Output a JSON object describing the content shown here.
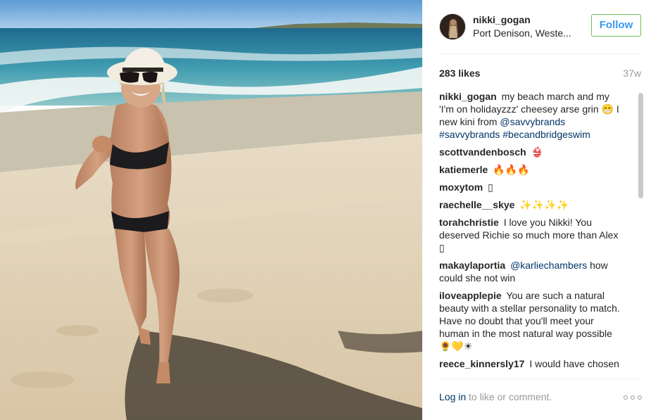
{
  "post": {
    "username": "nikki_gogan",
    "location": "Port Denison, Weste...",
    "follow_label": "Follow",
    "likes": "283 likes",
    "age": "37w"
  },
  "caption": {
    "author": "nikki_gogan",
    "text_1": "my beach march and my 'I'm on holidayzzz' cheesey arse grin 😁 I new kini from",
    "mention": "@savvybrands",
    "hashtags": "#savvybrands #becandbridgeswim"
  },
  "comments": [
    {
      "author": "scottvandenbosch",
      "text": "👙"
    },
    {
      "author": "katiemerle",
      "text": "🔥🔥🔥"
    },
    {
      "author": "moxytom",
      "text": "▯"
    },
    {
      "author": "raechelle__skye",
      "text": "✨✨✨✨"
    },
    {
      "author": "torahchristie",
      "text": "I love you Nikki! You deserved Richie so much more than Alex ▯"
    },
    {
      "author": "makaylaportia",
      "mention": "@karliechambers",
      "text": "how could she not win"
    },
    {
      "author": "iloveapplepie",
      "text": "You are such a natural beauty with a stellar personality to match. Have no doubt that you'll meet your human in the most natural way possible 🌻💛☀"
    },
    {
      "author": "reece_kinnersly17",
      "text": "I would have chosen"
    }
  ],
  "footer": {
    "login_link": "Log in",
    "login_text": "to like or comment."
  },
  "icons": {
    "more": "more-options-icon"
  },
  "colors": {
    "follow_text": "#3897f0",
    "follow_border": "#70c050",
    "link": "#003569",
    "muted": "#999999"
  }
}
